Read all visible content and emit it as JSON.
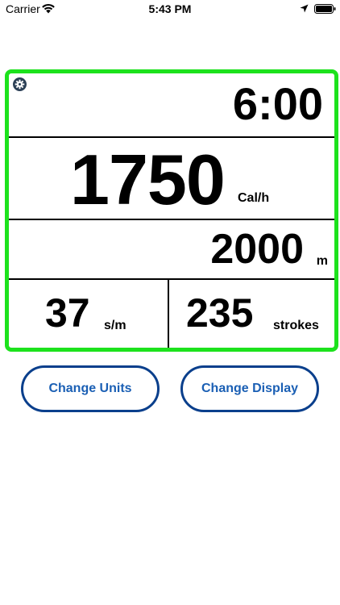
{
  "status_bar": {
    "carrier": "Carrier",
    "time": "5:43 PM",
    "icons": [
      "wifi-icon",
      "location-arrow-icon",
      "battery-icon"
    ]
  },
  "monitor": {
    "border_color": "#1de21d",
    "settings_icon": "gear-icon",
    "time": "6:00",
    "calories": {
      "value": "1750",
      "unit": "Cal/h"
    },
    "distance": {
      "value": "2000",
      "unit": "m"
    },
    "stroke_rate": {
      "value": "37",
      "unit": "s/m"
    },
    "strokes": {
      "value": "235",
      "unit": "strokes"
    }
  },
  "buttons": {
    "change_units": "Change Units",
    "change_display": "Change Display",
    "accent_color": "#1a5fb4",
    "border_color": "#0a3f8c"
  }
}
